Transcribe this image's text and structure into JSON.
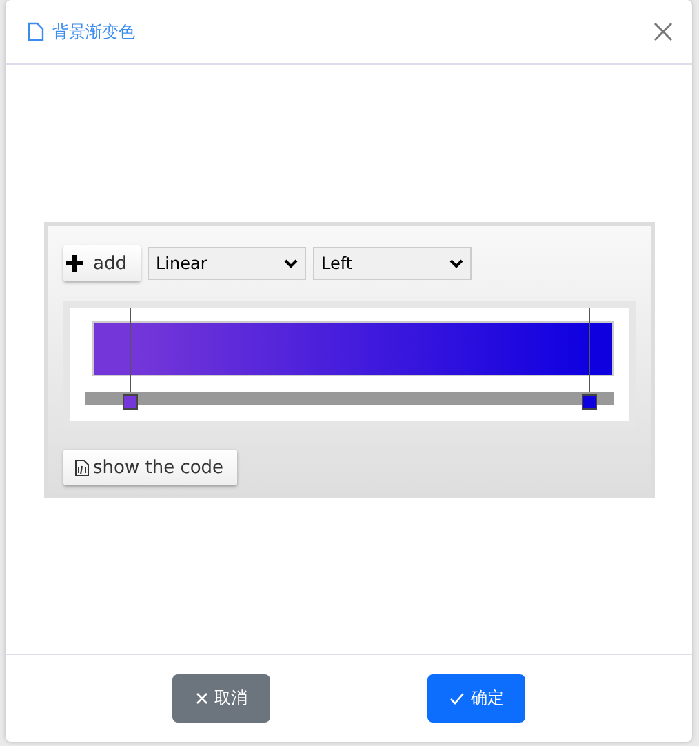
{
  "dialog": {
    "title": "背景渐变色"
  },
  "editor": {
    "add_button": "add",
    "type_select": {
      "value": "Linear"
    },
    "direction_select": {
      "value": "Left"
    },
    "stops": [
      {
        "color": "#7436d8",
        "level": 0.086
      },
      {
        "color": "#0f00e0",
        "level": 0.955
      }
    ],
    "code_button": "show the code"
  },
  "buttons": [
    {
      "label": "取消",
      "kind": "cancel"
    },
    {
      "label": "确定",
      "kind": "confirm"
    }
  ]
}
